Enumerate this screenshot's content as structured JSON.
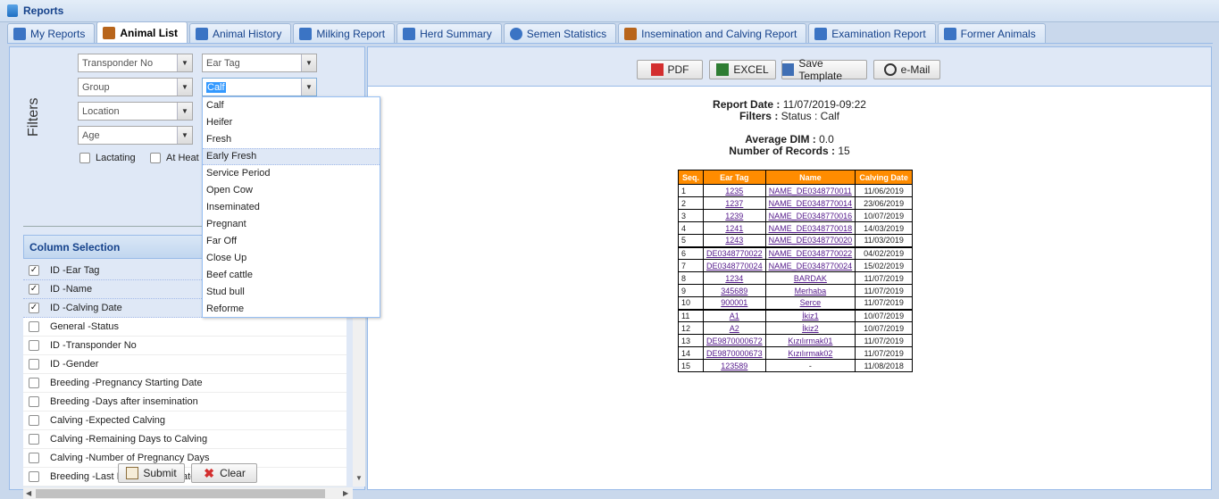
{
  "window": {
    "title": "Reports"
  },
  "tabs": [
    {
      "label": "My Reports",
      "color": "#3b74c4"
    },
    {
      "label": "Animal List",
      "color": "#b8651b"
    },
    {
      "label": "Animal History",
      "color": "#3b74c4"
    },
    {
      "label": "Milking Report",
      "color": "#3b74c4"
    },
    {
      "label": "Herd Summary",
      "color": "#3b74c4"
    },
    {
      "label": "Semen Statistics",
      "color": "#3b74c4"
    },
    {
      "label": "Insemination and Calving Report",
      "color": "#b8651b"
    },
    {
      "label": "Examination Report",
      "color": "#3b74c4"
    },
    {
      "label": "Former Animals",
      "color": "#3b74c4"
    }
  ],
  "filters": {
    "label": "Filters",
    "combos": [
      "Transponder No",
      "Ear Tag",
      "Group",
      "Calf",
      "Location",
      "Age"
    ],
    "checkboxes": [
      "Lactating",
      "At Heat"
    ]
  },
  "column_selection": {
    "title": "Column Selection",
    "items": [
      {
        "label": "ID -Ear Tag",
        "checked": true
      },
      {
        "label": "ID -Name",
        "checked": true
      },
      {
        "label": "ID -Calving Date",
        "checked": true
      },
      {
        "label": "General -Status",
        "checked": false
      },
      {
        "label": "ID -Transponder No",
        "checked": false
      },
      {
        "label": "ID -Gender",
        "checked": false
      },
      {
        "label": "Breeding -Pregnancy Starting Date",
        "checked": false
      },
      {
        "label": "Breeding -Days after insemination",
        "checked": false
      },
      {
        "label": "Calving -Expected Calving",
        "checked": false
      },
      {
        "label": "Calving -Remaining Days to Calving",
        "checked": false
      },
      {
        "label": "Calving -Number of Pregnancy Days",
        "checked": false
      },
      {
        "label": "Breeding -Last Insemination Date",
        "checked": false
      }
    ]
  },
  "buttons": {
    "submit": "Submit",
    "clear": "Clear"
  },
  "toolbar": {
    "pdf": "PDF",
    "excel": "EXCEL",
    "save_template": "Save Template",
    "email": "e-Mail"
  },
  "report": {
    "report_date_label": "Report Date :",
    "report_date": "11/07/2019-09:22",
    "filters_label": "Filters :",
    "filters_value": "Status : Calf",
    "avg_dim_label": "Average DIM :",
    "avg_dim": "0.0",
    "records_label": "Number of Records :",
    "records": "15",
    "columns": [
      "Seq.",
      "Ear Tag",
      "Name",
      "Calving Date"
    ],
    "rows": [
      [
        "1",
        "1235",
        "NAME_DE0348770011",
        "11/06/2019"
      ],
      [
        "2",
        "1237",
        "NAME_DE0348770014",
        "23/06/2019"
      ],
      [
        "3",
        "1239",
        "NAME_DE0348770016",
        "10/07/2019"
      ],
      [
        "4",
        "1241",
        "NAME_DE0348770018",
        "14/03/2019"
      ],
      [
        "5",
        "1243",
        "NAME_DE0348770020",
        "11/03/2019"
      ],
      [
        "6",
        "DE0348770022",
        "NAME_DE0348770022",
        "04/02/2019"
      ],
      [
        "7",
        "DE0348770024",
        "NAME_DE0348770024",
        "15/02/2019"
      ],
      [
        "8",
        "1234",
        "BARDAK",
        "11/07/2019"
      ],
      [
        "9",
        "345689",
        "Merhaba",
        "11/07/2019"
      ],
      [
        "10",
        "900001",
        "Serce",
        "11/07/2019"
      ],
      [
        "11",
        "A1",
        "İkiz1",
        "10/07/2019"
      ],
      [
        "12",
        "A2",
        "İkiz2",
        "10/07/2019"
      ],
      [
        "13",
        "DE9870000672",
        "Kızılırmak01",
        "11/07/2019"
      ],
      [
        "14",
        "DE9870000673",
        "Kızılırmak02",
        "11/07/2019"
      ],
      [
        "15",
        "123589",
        "-",
        "11/08/2018"
      ]
    ]
  },
  "dropdown": {
    "items": [
      "Calf",
      "Heifer",
      "Fresh",
      "Early Fresh",
      "Service Period",
      "Open Cow",
      "Inseminated",
      "Pregnant",
      "Far Off",
      "Close Up",
      "Beef cattle",
      "Stud bull",
      "Reforme"
    ],
    "highlighted": "Early Fresh"
  },
  "colors": {
    "header_orange": "#ff8c00",
    "link_purple": "#551a8b",
    "panel_blue": "#dfe8f6",
    "title_blue": "#15428b"
  }
}
